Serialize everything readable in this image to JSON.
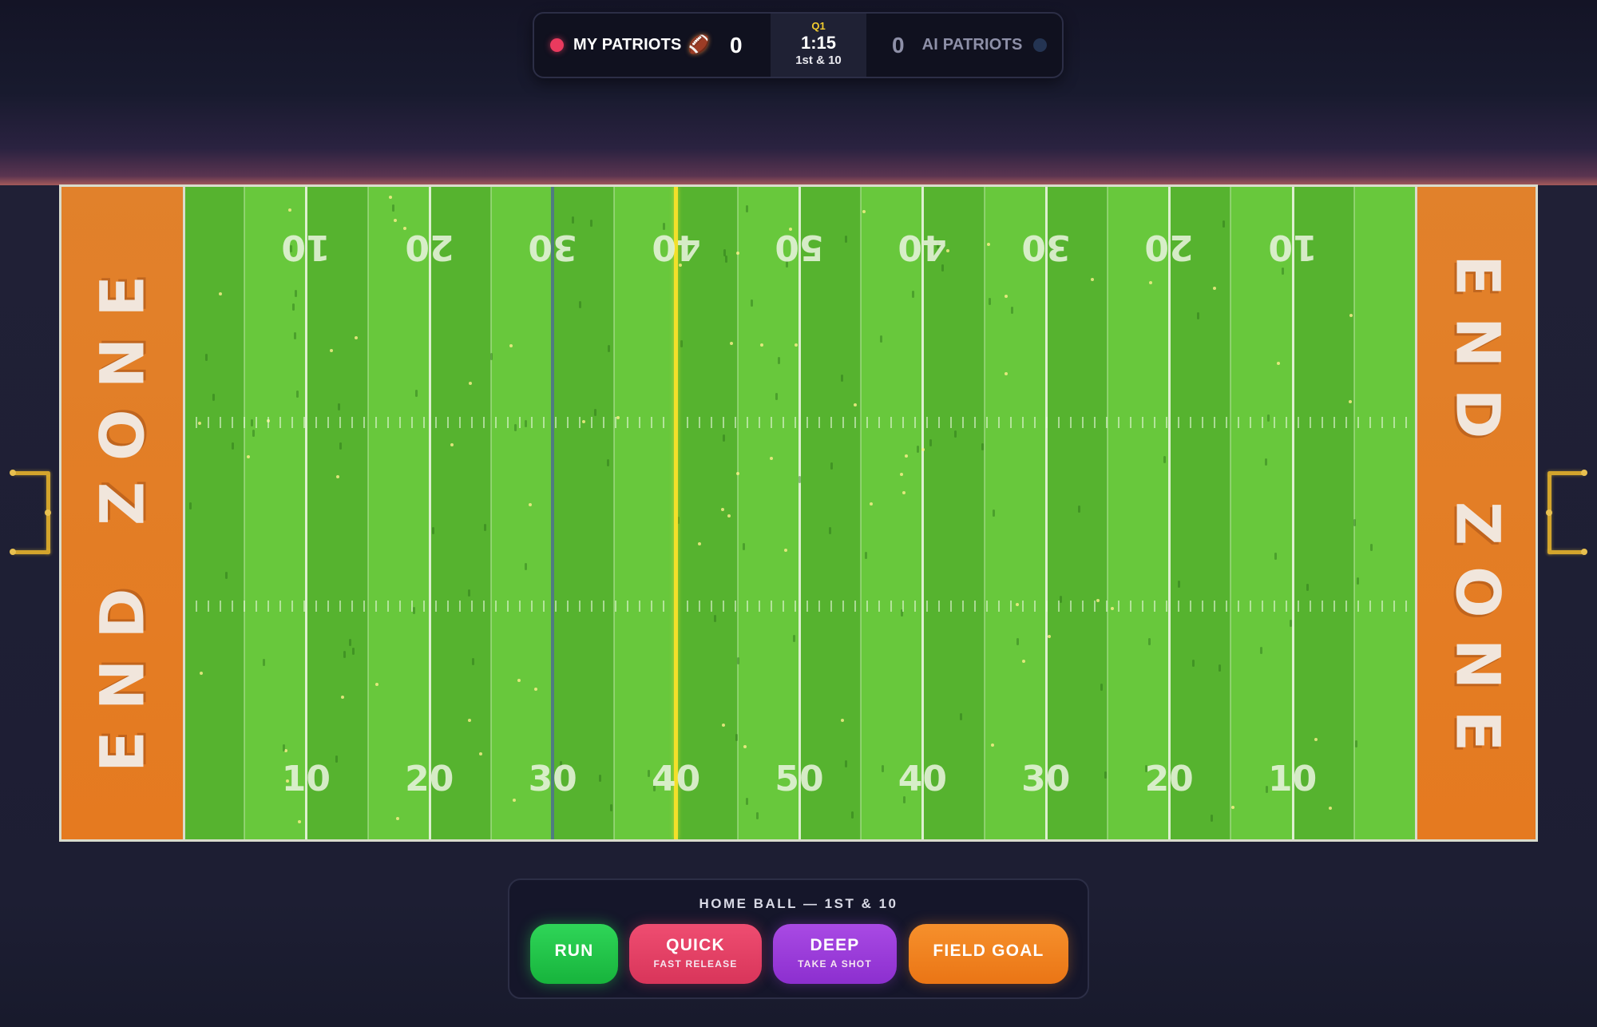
{
  "scoreboard": {
    "home": {
      "name": "MY PATRIOTS",
      "score": "0",
      "ball_icon": "🏈",
      "dot_color": "#ea3a5e"
    },
    "away": {
      "name": "AI PATRIOTS",
      "score": "0",
      "dot_color": "#243452"
    },
    "quarter": "Q1",
    "clock": "1:15",
    "down": "1st & 10"
  },
  "field": {
    "endzone_left": "END ZONE",
    "endzone_right": "END ZONE",
    "yard_numbers": [
      "10",
      "20",
      "30",
      "40",
      "50",
      "40",
      "30",
      "20",
      "10"
    ],
    "line_of_scrimmage_color": "#4f7c82",
    "first_down_line_color": "#f3e02a",
    "endzone_color": "#e57a20"
  },
  "controls": {
    "title": "HOME BALL — 1ST & 10",
    "run": {
      "label": "RUN"
    },
    "quick": {
      "label": "QUICK",
      "sub": "FAST RELEASE"
    },
    "deep": {
      "label": "DEEP",
      "sub": "TAKE A SHOT"
    },
    "field_goal": {
      "label": "FIELD GOAL"
    }
  }
}
